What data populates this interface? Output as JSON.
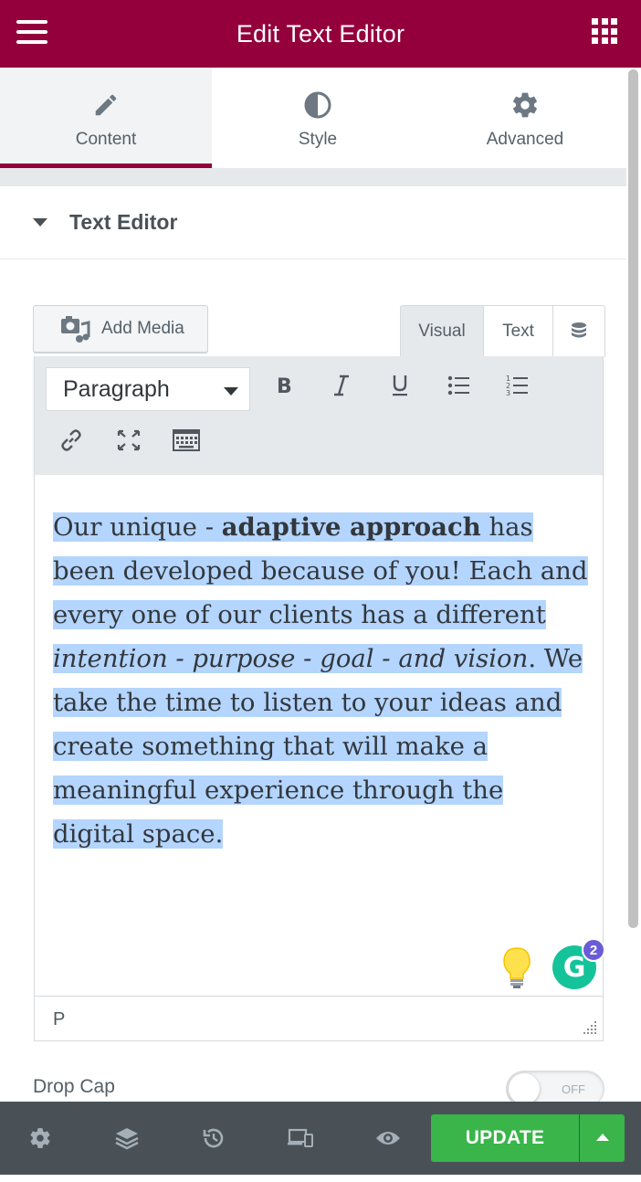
{
  "header": {
    "title": "Edit Text Editor"
  },
  "tabs": [
    {
      "label": "Content",
      "icon": "pencil-icon",
      "active": true
    },
    {
      "label": "Style",
      "icon": "half-circle-icon",
      "active": false
    },
    {
      "label": "Advanced",
      "icon": "gear-icon",
      "active": false
    }
  ],
  "section": {
    "title": "Text Editor"
  },
  "media": {
    "add_label": "Add Media"
  },
  "editor_modes": {
    "visual": "Visual",
    "text": "Text"
  },
  "toolbar": {
    "format_value": "Paragraph",
    "buttons": [
      "bold",
      "italic",
      "underline",
      "bullet-list",
      "numbered-list",
      "link",
      "fullscreen",
      "toolbar-toggle"
    ]
  },
  "content": {
    "p1": "Our unique - ",
    "bold": "adaptive approach",
    "p2": " has been developed because of you! Each and every one of our clients has a different ",
    "italic1": "intention - purpose - goal - and vision",
    "p3": ". We take the time to listen to your ideas and create something that will make a meaningful experience through the digital space."
  },
  "grammarly": {
    "count": "2"
  },
  "status": {
    "path": "P"
  },
  "dropcap": {
    "label": "Drop Cap",
    "state": "OFF"
  },
  "footer": {
    "update_label": "UPDATE"
  },
  "colors": {
    "brand": "#93003c",
    "update": "#39b54a",
    "footer": "#495157",
    "selection": "#b4d5fe"
  }
}
